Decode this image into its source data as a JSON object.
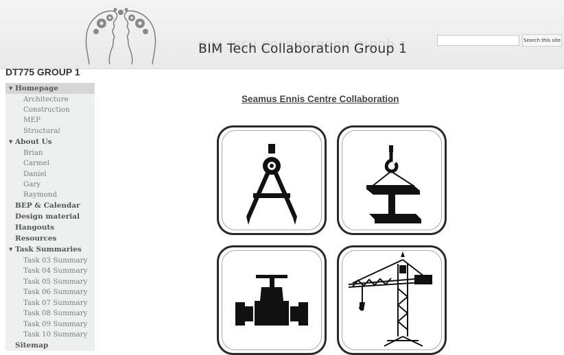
{
  "header": {
    "site_title": "BIM Tech Collaboration Group 1",
    "search_placeholder": "",
    "search_button": "Search this site"
  },
  "group_title": "DT775 GROUP 1",
  "sidebar": {
    "items": [
      {
        "label": "Homepage",
        "level": 0,
        "expanded": true,
        "active": true
      },
      {
        "label": "Architecture",
        "level": 1
      },
      {
        "label": "Construction",
        "level": 1
      },
      {
        "label": "MEP",
        "level": 1
      },
      {
        "label": "Structural",
        "level": 1
      },
      {
        "label": "About Us",
        "level": 0,
        "expanded": true
      },
      {
        "label": "Brian",
        "level": 1
      },
      {
        "label": "Carmel",
        "level": 1
      },
      {
        "label": "Daniel",
        "level": 1
      },
      {
        "label": "Gary",
        "level": 1
      },
      {
        "label": "Raymond",
        "level": 1
      },
      {
        "label": "BEP & Calendar",
        "level": 0
      },
      {
        "label": "Design material",
        "level": 0
      },
      {
        "label": "Hangouts",
        "level": 0
      },
      {
        "label": "Resources",
        "level": 0
      },
      {
        "label": "Task Summaries",
        "level": 0,
        "expanded": true
      },
      {
        "label": "Task 03 Summary",
        "level": 1
      },
      {
        "label": "Task 04 Summary",
        "level": 1
      },
      {
        "label": "Task 05 Summary",
        "level": 1
      },
      {
        "label": "Task 06 Summary",
        "level": 1
      },
      {
        "label": "Task 07 Summary",
        "level": 1
      },
      {
        "label": "Task 08 Summary",
        "level": 1
      },
      {
        "label": "Task 09 Summary",
        "level": 1
      },
      {
        "label": "Task 10 Summary",
        "level": 1
      },
      {
        "label": "Sitemap",
        "level": 0
      }
    ]
  },
  "main": {
    "heading": "Seamus Ennis Centre Collaboration",
    "tiles": [
      {
        "icon": "compass-icon"
      },
      {
        "icon": "steel-beam-hook-icon"
      },
      {
        "icon": "pipe-valve-icon"
      },
      {
        "icon": "tower-crane-icon"
      }
    ]
  },
  "colors": {
    "header_bg": "#eeeeee",
    "sidebar_bg": "#eef0ef",
    "active_item_bg": "#d6d6d6",
    "tile_border": "#2a2a2a"
  }
}
